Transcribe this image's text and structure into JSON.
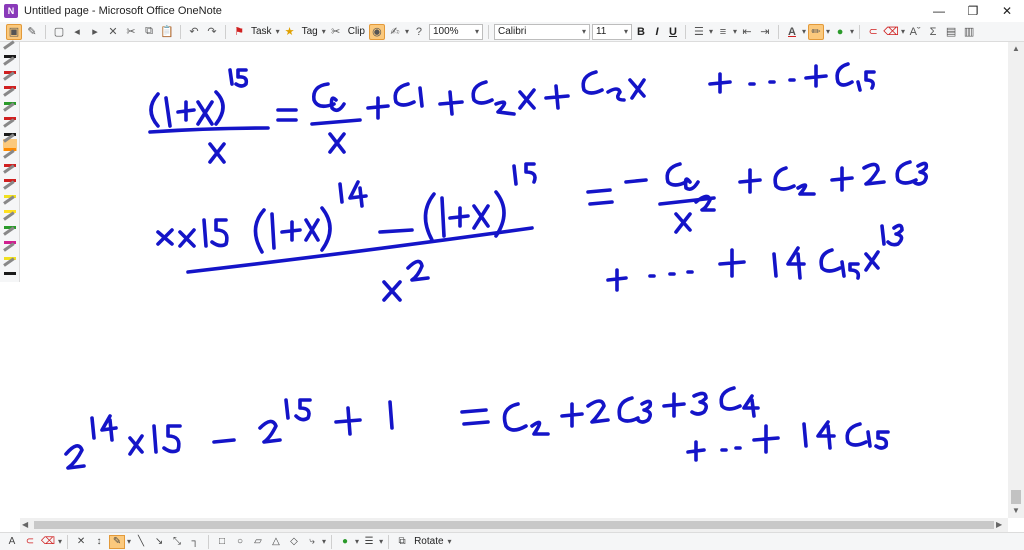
{
  "window": {
    "title": "Untitled page - Microsoft Office OneNote",
    "minimize": "—",
    "restore": "❐",
    "close": "✕"
  },
  "toolbar": {
    "task_label": "Task",
    "tag_label": "Tag",
    "clip_label": "Clip",
    "zoom_value": "100%",
    "font_value": "Calibri",
    "size_value": "11",
    "bold": "B",
    "italic": "I",
    "underline": "U"
  },
  "drawbar": {
    "rotate_label": "Rotate"
  },
  "colors": {
    "ink": "#1414c8",
    "highlight": "#fbc97d",
    "toolbar_bg": "#f5f6f7"
  },
  "pens": [
    "#1a1a1a",
    "#d02020",
    "#d02020",
    "#2a9a2a",
    "#d02020",
    "#1a1a1a",
    "#ff8a00",
    "#d02020",
    "#d02020",
    "#f0e020",
    "#ffe020",
    "#2a9a2a",
    "#d02090",
    "#f0e020",
    "#1a1a1a"
  ]
}
